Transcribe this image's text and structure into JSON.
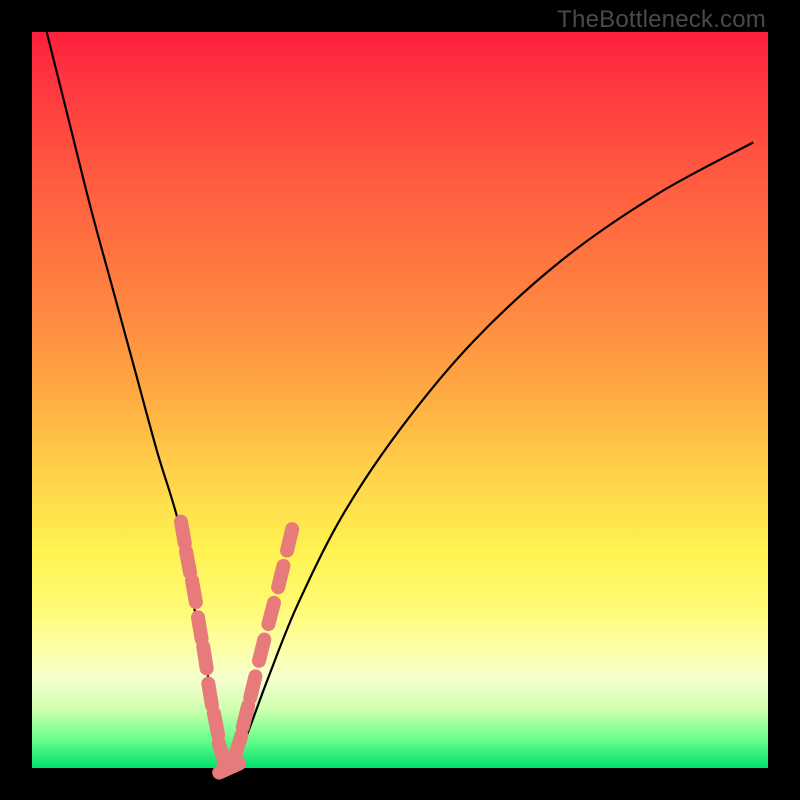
{
  "watermark": "TheBottleneck.com",
  "colors": {
    "frame": "#000000",
    "curve": "#000000",
    "marker": "#e77b7b"
  },
  "chart_data": {
    "type": "line",
    "title": "",
    "xlabel": "",
    "ylabel": "",
    "xlim": [
      0,
      100
    ],
    "ylim": [
      0,
      100
    ],
    "series": [
      {
        "name": "bottleneck-curve",
        "x": [
          2,
          5,
          8,
          11,
          14,
          17,
          20,
          22,
          24,
          25.5,
          27,
          29,
          32,
          36,
          42,
          50,
          60,
          72,
          85,
          98
        ],
        "y": [
          100,
          88,
          76,
          65,
          54,
          43,
          33,
          22,
          12,
          3,
          0,
          4,
          12,
          22,
          34,
          46,
          58,
          69,
          78,
          85
        ]
      }
    ],
    "markers": {
      "name": "highlighted-points",
      "x": [
        20.5,
        21.2,
        22.0,
        22.8,
        23.5,
        24.2,
        25.0,
        25.8,
        26.8,
        28.0,
        29.0,
        30.0,
        31.2,
        32.5,
        33.8,
        35.0
      ],
      "y": [
        32,
        28,
        24,
        19,
        15,
        10,
        6,
        2,
        0,
        3,
        7,
        11,
        16,
        21,
        26,
        31
      ]
    },
    "annotations": []
  }
}
